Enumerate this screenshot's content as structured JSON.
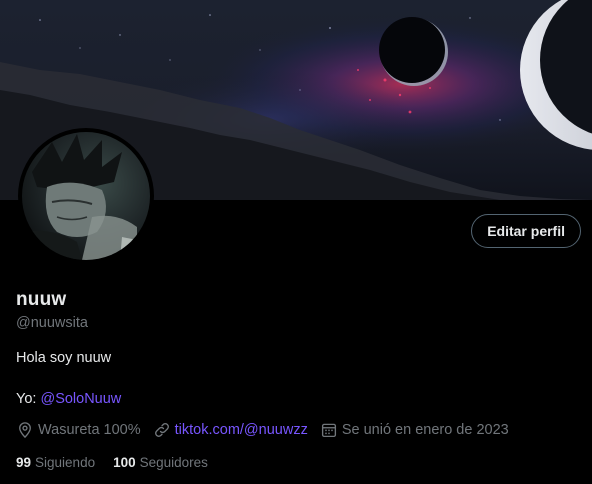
{
  "profile": {
    "name": "nuuw",
    "handle": "@nuuwsita",
    "bio": "Hola soy nuuw",
    "yo_label": "Yo:",
    "yo_mention": "@SoloNuuw",
    "location": "Wasureta 100%",
    "link": "tiktok.com/@nuuwzz",
    "joined": "Se unió en enero de 2023",
    "following_count": "99",
    "following_label": "Siguiendo",
    "followers_count": "100",
    "followers_label": "Seguidores"
  },
  "actions": {
    "edit_profile_label": "Editar perfil"
  },
  "icons": {
    "location": "location-pin-icon",
    "link": "link-icon",
    "calendar": "calendar-icon"
  },
  "colors": {
    "accent": "#7856ff",
    "secondary_text": "#71767b",
    "primary_text": "#e7e9ea",
    "background": "#000000"
  }
}
